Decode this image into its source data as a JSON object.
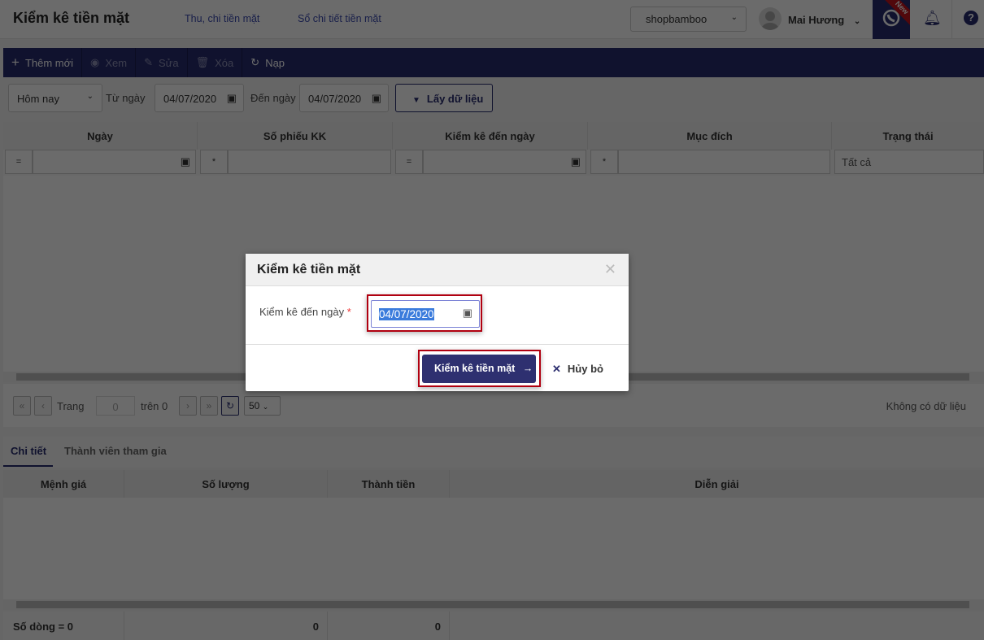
{
  "header": {
    "title": "Kiểm kê tiền mặt",
    "links": [
      "Thu, chi tiền mặt",
      "Sổ chi tiết tiền mặt"
    ],
    "shop": "shopbamboo",
    "user": "Mai Hương",
    "new_badge": "New"
  },
  "toolbar": {
    "add": "Thêm mới",
    "view": "Xem",
    "edit": "Sửa",
    "delete": "Xóa",
    "reload": "Nạp"
  },
  "filter": {
    "period": "Hôm nay",
    "from_label": "Từ ngày",
    "from": "04/07/2020",
    "to_label": "Đến ngày",
    "to": "04/07/2020",
    "fetch": "Lấy dữ liệu"
  },
  "grid": {
    "columns": [
      "Ngày",
      "Số phiếu KK",
      "Kiểm kê đến ngày",
      "Mục đích",
      "Trạng thái"
    ],
    "ops": [
      "=",
      "*",
      "=",
      "*"
    ],
    "status_filter": "Tất cả"
  },
  "pager": {
    "page_label": "Trang",
    "page": "0",
    "of": "trên 0",
    "size": "50",
    "empty": "Không có dữ liệu"
  },
  "tabs": [
    "Chi tiết",
    "Thành viên tham gia"
  ],
  "detail": {
    "columns": [
      "Mệnh giá",
      "Số lượng",
      "Thành tiền",
      "Diễn giải"
    ],
    "footer": {
      "rows": "Số dòng = 0",
      "qty": "0",
      "amount": "0"
    }
  },
  "dialog": {
    "title": "Kiểm kê tiền mặt",
    "field_label": "Kiểm kê đến ngày",
    "required": "*",
    "date": "04/07/2020",
    "submit": "Kiểm kê tiền mặt",
    "cancel": "Hủy bỏ"
  },
  "colors": {
    "navy": "#262a6e",
    "highlight": "#b00010"
  }
}
